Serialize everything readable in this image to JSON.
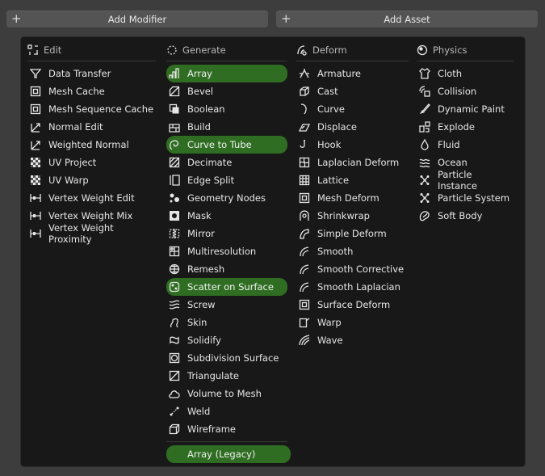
{
  "top_buttons": {
    "add_modifier": "Add Modifier",
    "add_asset": "Add Asset"
  },
  "columns": [
    {
      "title": "Edit",
      "icon": "edit-icon",
      "items": [
        {
          "label": "Data Transfer",
          "icon": "data-transfer-icon"
        },
        {
          "label": "Mesh Cache",
          "icon": "mesh-cache-icon"
        },
        {
          "label": "Mesh Sequence Cache",
          "icon": "mesh-sequence-cache-icon"
        },
        {
          "label": "Normal Edit",
          "icon": "normal-edit-icon"
        },
        {
          "label": "Weighted Normal",
          "icon": "weighted-normal-icon"
        },
        {
          "label": "UV Project",
          "icon": "uv-project-icon"
        },
        {
          "label": "UV Warp",
          "icon": "uv-warp-icon"
        },
        {
          "label": "Vertex Weight Edit",
          "icon": "vertex-weight-icon"
        },
        {
          "label": "Vertex Weight Mix",
          "icon": "vertex-weight-icon"
        },
        {
          "label": "Vertex Weight Proximity",
          "icon": "vertex-weight-icon"
        }
      ]
    },
    {
      "title": "Generate",
      "icon": "generate-icon",
      "items": [
        {
          "label": "Array",
          "icon": "array-icon",
          "highlight": true
        },
        {
          "label": "Bevel",
          "icon": "bevel-icon"
        },
        {
          "label": "Boolean",
          "icon": "boolean-icon"
        },
        {
          "label": "Build",
          "icon": "build-icon"
        },
        {
          "label": "Curve to Tube",
          "icon": "curve-to-tube-icon",
          "highlight": true
        },
        {
          "label": "Decimate",
          "icon": "decimate-icon"
        },
        {
          "label": "Edge Split",
          "icon": "edge-split-icon"
        },
        {
          "label": "Geometry Nodes",
          "icon": "geometry-nodes-icon"
        },
        {
          "label": "Mask",
          "icon": "mask-icon"
        },
        {
          "label": "Mirror",
          "icon": "mirror-icon"
        },
        {
          "label": "Multiresolution",
          "icon": "multiresolution-icon"
        },
        {
          "label": "Remesh",
          "icon": "remesh-icon"
        },
        {
          "label": "Scatter on Surface",
          "icon": "scatter-icon",
          "highlight": true
        },
        {
          "label": "Screw",
          "icon": "screw-icon"
        },
        {
          "label": "Skin",
          "icon": "skin-icon"
        },
        {
          "label": "Solidify",
          "icon": "solidify-icon"
        },
        {
          "label": "Subdivision Surface",
          "icon": "subdivision-icon"
        },
        {
          "label": "Triangulate",
          "icon": "triangulate-icon"
        },
        {
          "label": "Volume to Mesh",
          "icon": "volume-to-mesh-icon"
        },
        {
          "label": "Weld",
          "icon": "weld-icon"
        },
        {
          "label": "Wireframe",
          "icon": "wireframe-icon"
        }
      ],
      "legacy": {
        "label": "Array (Legacy)",
        "highlight": true
      }
    },
    {
      "title": "Deform",
      "icon": "deform-icon",
      "items": [
        {
          "label": "Armature",
          "icon": "armature-icon"
        },
        {
          "label": "Cast",
          "icon": "cast-icon"
        },
        {
          "label": "Curve",
          "icon": "curve-icon"
        },
        {
          "label": "Displace",
          "icon": "displace-icon"
        },
        {
          "label": "Hook",
          "icon": "hook-icon"
        },
        {
          "label": "Laplacian Deform",
          "icon": "laplacian-deform-icon"
        },
        {
          "label": "Lattice",
          "icon": "lattice-icon"
        },
        {
          "label": "Mesh Deform",
          "icon": "mesh-deform-icon"
        },
        {
          "label": "Shrinkwrap",
          "icon": "shrinkwrap-icon"
        },
        {
          "label": "Simple Deform",
          "icon": "simple-deform-icon"
        },
        {
          "label": "Smooth",
          "icon": "smooth-icon"
        },
        {
          "label": "Smooth Corrective",
          "icon": "smooth-icon"
        },
        {
          "label": "Smooth Laplacian",
          "icon": "smooth-icon"
        },
        {
          "label": "Surface Deform",
          "icon": "surface-deform-icon"
        },
        {
          "label": "Warp",
          "icon": "warp-icon"
        },
        {
          "label": "Wave",
          "icon": "wave-icon"
        }
      ]
    },
    {
      "title": "Physics",
      "icon": "physics-icon",
      "items": [
        {
          "label": "Cloth",
          "icon": "cloth-icon"
        },
        {
          "label": "Collision",
          "icon": "collision-icon"
        },
        {
          "label": "Dynamic Paint",
          "icon": "dynamic-paint-icon"
        },
        {
          "label": "Explode",
          "icon": "explode-icon"
        },
        {
          "label": "Fluid",
          "icon": "fluid-icon"
        },
        {
          "label": "Ocean",
          "icon": "ocean-icon"
        },
        {
          "label": "Particle Instance",
          "icon": "particle-instance-icon"
        },
        {
          "label": "Particle System",
          "icon": "particle-system-icon"
        },
        {
          "label": "Soft Body",
          "icon": "soft-body-icon"
        }
      ]
    }
  ],
  "colors": {
    "highlight": "#2f6e22",
    "panel": "#181818",
    "background": "#3d3d3d"
  }
}
